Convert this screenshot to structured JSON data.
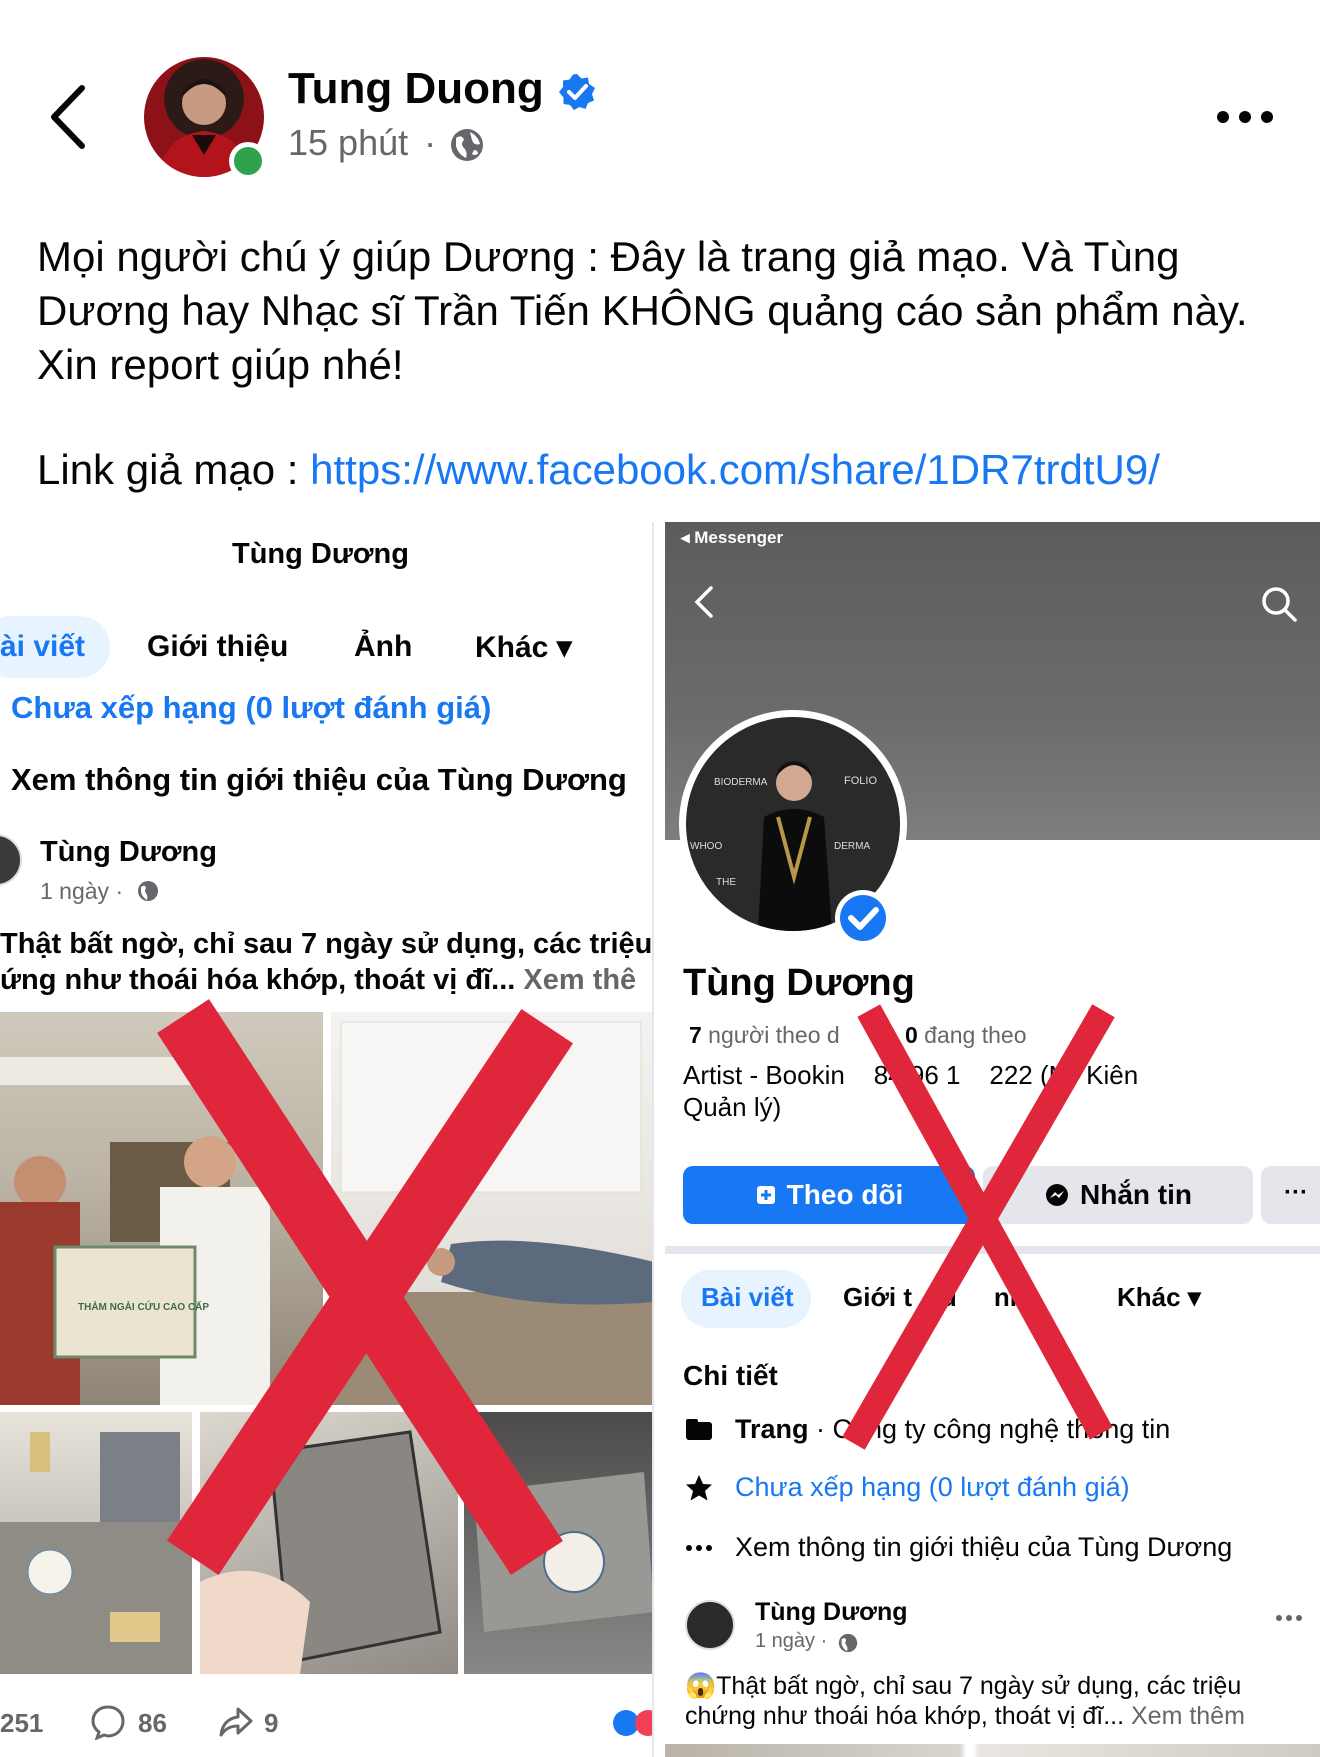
{
  "post": {
    "author": "Tung Duong",
    "time": "15 phút",
    "dot": "·",
    "caption": "Mọi người chú ý giúp Dương :  Đây là trang giả mạo. Và Tùng Dương hay Nhạc sĩ Trần Tiến KHÔNG quảng cáo sản phẩm này. Xin report giúp nhé!",
    "link_label": "Link giả mạo : ",
    "link_url": "https://www.facebook.com/share/1DR7trdtU9/"
  },
  "left": {
    "page_title": "Tùng Dương",
    "tabs": [
      "ài viết",
      "Giới thiệu",
      "Ảnh",
      "Khác ▾"
    ],
    "rating": "Chưa xếp hạng (0 lượt đánh giá)",
    "about": "Xem thông tin giới thiệu của Tùng Dương",
    "poster": "Tùng Dương",
    "poster_time": "1 ngày ·",
    "text1": "Thật bất ngờ, chỉ sau 7 ngày sử dụng, các triệu",
    "text2": "ứng như thoái hóa khớp, thoát vị đĩ... ",
    "see_more": "Xem thê",
    "bag_text": "THẢM NGẢI CỨU CAO CẤP",
    "reactions": "251",
    "comments": "86",
    "shares": "9"
  },
  "right": {
    "status_app": "◂ Messenger",
    "name": "Tùng Dương",
    "followers": "7",
    "followers_label": " người theo d",
    "following": "0",
    "following_label": " đang theo",
    "bio1": "Artist - Bookin    84 96 1    222 (Mr Kiên",
    "bio2": "Quản lý)",
    "follow_btn": "Theo dõi",
    "message_btn": "Nhắn tin",
    "more_btn": "···",
    "tabs": [
      "Bài viết",
      "Giới t    u",
      "    nh",
      "Khác ▾"
    ],
    "details_title": "Chi tiết",
    "page_label": "Trang",
    "page_category": " · Công ty công nghệ thông tin",
    "rating": "Chưa xếp hạng (0 lượt đánh giá)",
    "about": "Xem thông tin giới thiệu của Tùng Dương",
    "poster": "Tùng Dương",
    "poster_time": "1 ngày ·",
    "text1": "😱Thật bất ngờ, chỉ sau 7 ngày sử dụng, các triệu",
    "text2": "chứng như thoái hóa khớp, thoát vị đĩ... ",
    "see_more": "Xem thêm",
    "backdrop_words": [
      "BIODERMA",
      "FOLIO",
      "WHOO",
      "THE",
      "DERMA"
    ]
  },
  "colors": {
    "accent": "#1877f2",
    "cross": "#e0263a",
    "online": "#31a24c"
  }
}
